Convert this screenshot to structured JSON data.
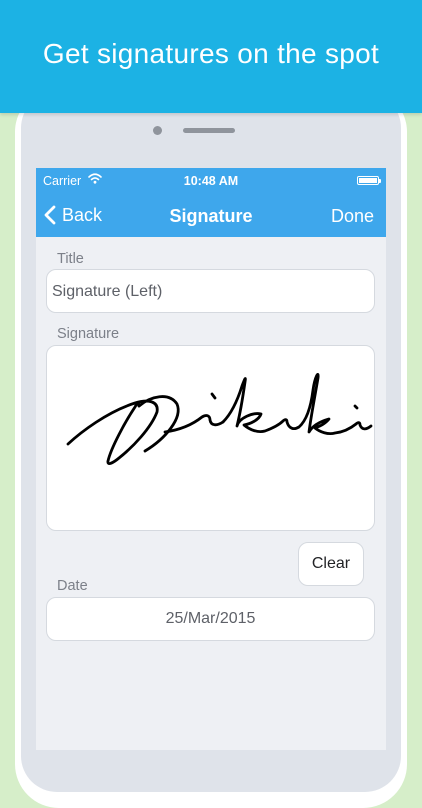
{
  "banner": {
    "headline": "Get signatures on the spot"
  },
  "statusbar": {
    "carrier": "Carrier",
    "time": "10:48 AM",
    "wifi_icon": "wifi-icon",
    "battery_icon": "battery-icon"
  },
  "navbar": {
    "back_label": "Back",
    "title": "Signature",
    "done_label": "Done",
    "back_icon": "chevron-left-icon"
  },
  "form": {
    "title_label": "Title",
    "title_value": "Signature (Left)",
    "signature_label": "Signature",
    "clear_label": "Clear",
    "date_label": "Date",
    "date_value": "25/Mar/2015"
  },
  "colors": {
    "banner": "#1cb2e4",
    "navbar": "#3ea7ec",
    "background": "#d6eec9",
    "ink": "#000000"
  }
}
